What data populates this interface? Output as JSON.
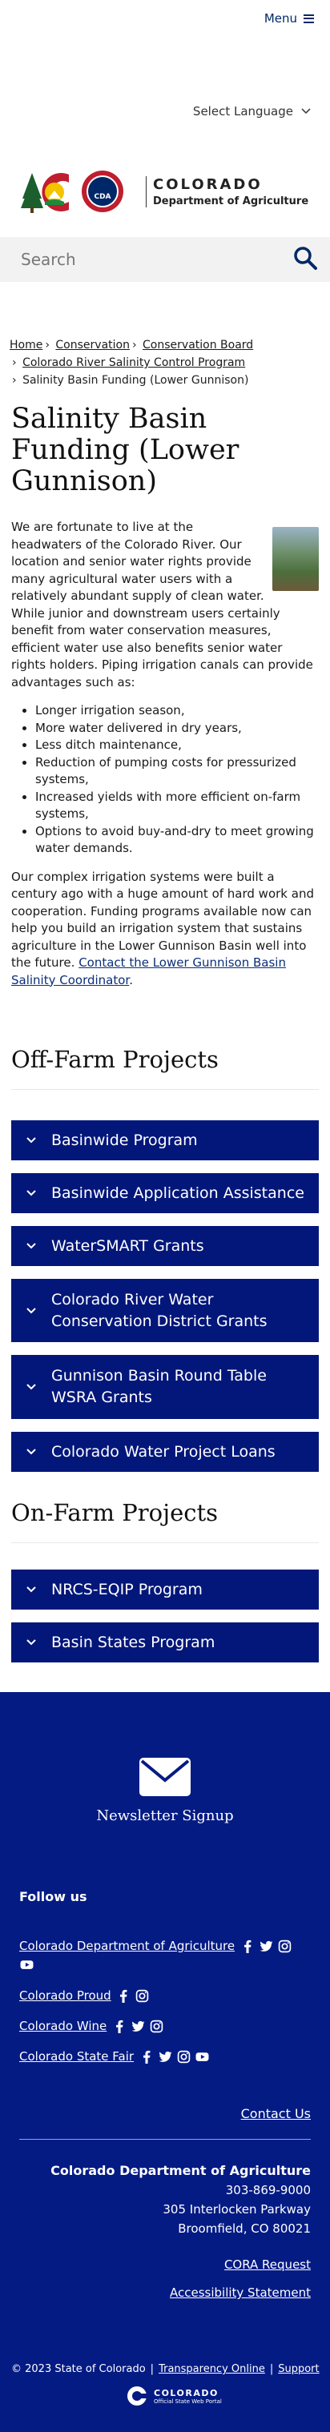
{
  "header": {
    "menu_label": "Menu",
    "language_label": "Select Language",
    "logo_title": "COLORADO",
    "logo_subtitle": "Department of Agriculture",
    "logo_badge": "CDA",
    "search_placeholder": "Search"
  },
  "breadcrumb": {
    "items": [
      "Home",
      "Conservation",
      "Conservation Board",
      "Colorado River Salinity Control Program"
    ],
    "current": "Salinity Basin Funding (Lower Gunnison)"
  },
  "page": {
    "title": "Salinity Basin Funding (Lower Gunnison)",
    "intro": "We are fortunate to live at the headwaters of the Colorado River. Our location and senior water rights provide many agricultural water users with a relatively abundant supply of clean water. While junior and downstream users certainly benefit from water conservation measures, efficient water use also benefits senior water rights holders. Piping irrigation canals can provide advantages such as:",
    "benefits": [
      "Longer irrigation season,",
      "More water delivered in dry years,",
      "Less ditch maintenance,",
      "Reduction of pumping costs for pressurized systems,",
      "Increased yields with more efficient on-farm systems,",
      "Options to avoid buy-and-dry to meet growing water demands."
    ],
    "closing": "Our complex irrigation systems were built a century ago with a huge amount of hard work and cooperation. Funding programs available now can help you build an irrigation system that sustains agriculture in the Lower Gunnison Basin well into the future.",
    "closing_link": "Contact the Lower Gunnison Basin Salinity Coordinator"
  },
  "off_farm": {
    "heading": "Off-Farm Projects",
    "items": [
      "Basinwide Program",
      "Basinwide Application Assistance",
      "WaterSMART Grants",
      "Colorado River Water Conservation District Grants",
      "Gunnison Basin Round Table WSRA Grants",
      "Colorado Water Project Loans"
    ]
  },
  "on_farm": {
    "heading": "On-Farm Projects",
    "items": [
      "NRCS-EQIP Program",
      "Basin States Program"
    ]
  },
  "footer": {
    "newsletter": "Newsletter Signup",
    "follow_us": "Follow us",
    "social": [
      {
        "name": "Colorado Department of Agriculture",
        "icons": [
          "facebook-icon",
          "twitter-icon",
          "instagram-icon",
          "youtube-icon"
        ]
      },
      {
        "name": "Colorado Proud",
        "icons": [
          "facebook-icon",
          "instagram-icon"
        ]
      },
      {
        "name": "Colorado Wine",
        "icons": [
          "facebook-icon",
          "twitter-icon",
          "instagram-icon"
        ]
      },
      {
        "name": "Colorado State Fair",
        "icons": [
          "facebook-icon",
          "twitter-icon",
          "instagram-icon",
          "youtube-icon"
        ]
      }
    ],
    "contact_us": "Contact Us",
    "org": "Colorado Department of Agriculture",
    "phone": "303-869-9000",
    "street": "305 Interlocken Parkway",
    "city": "Broomfield, CO 80021",
    "cora": "CORA Request",
    "accessibility": "Accessibility Statement",
    "copyright": "© 2023 State of Colorado",
    "transparency": "Transparency Online",
    "support": "Support",
    "portal_title": "COLORADO",
    "portal_sub": "Official State Web Portal"
  },
  "colors": {
    "accent": "#03177a",
    "footer": "#041b84"
  }
}
